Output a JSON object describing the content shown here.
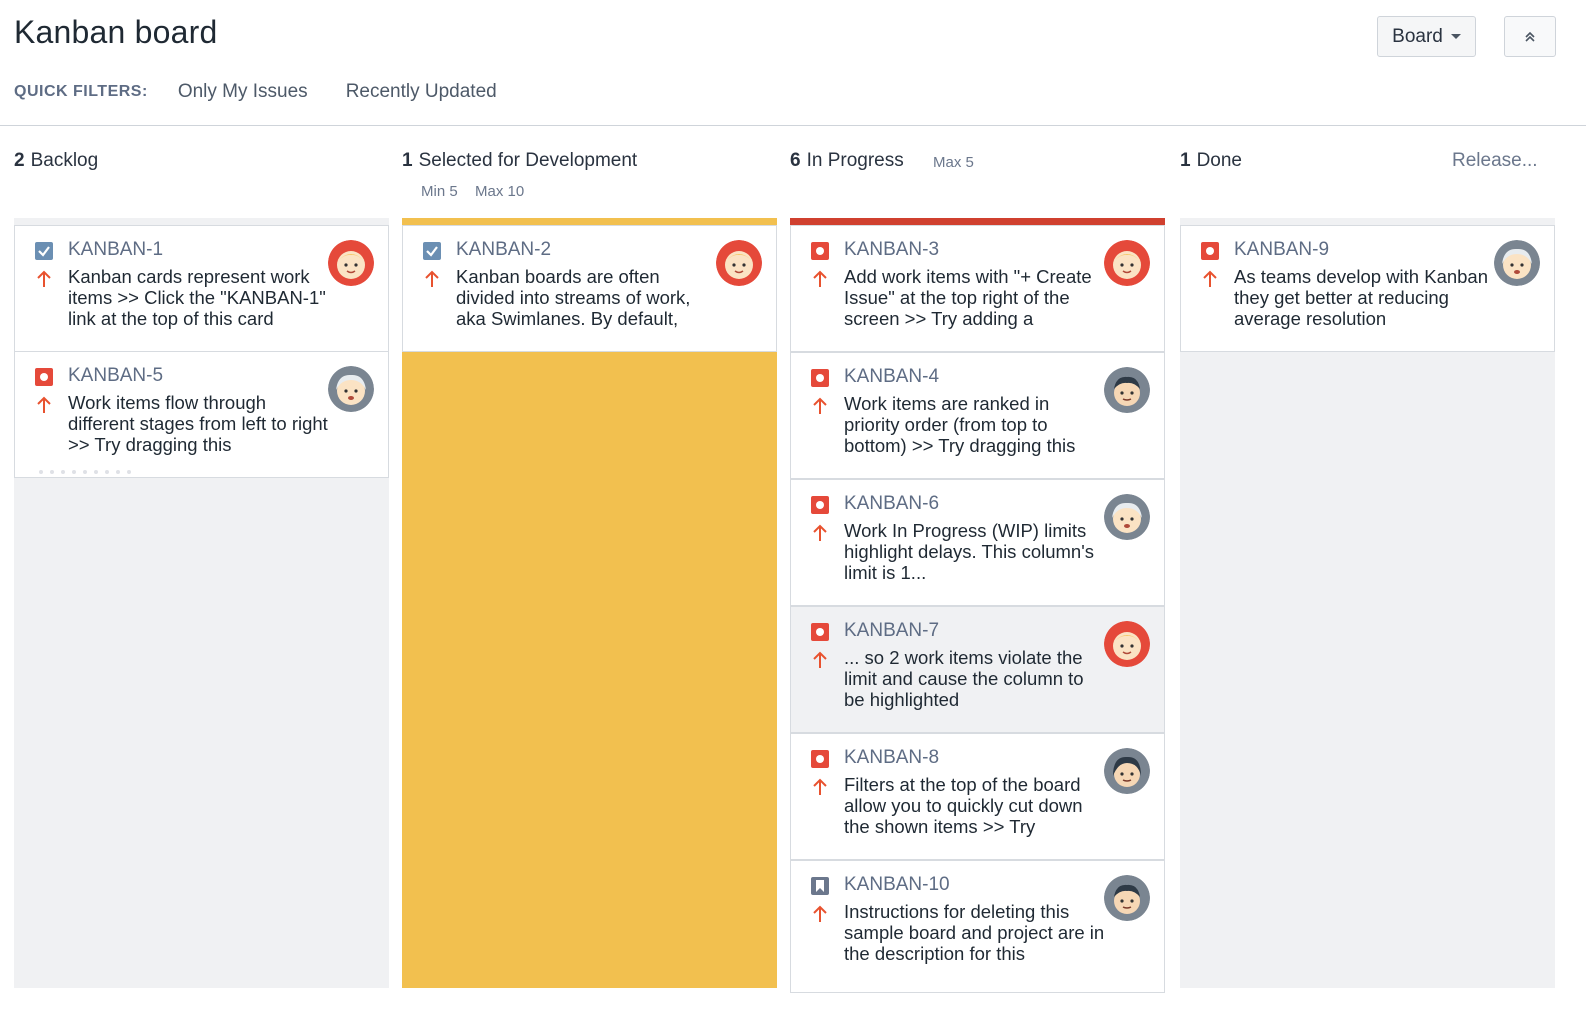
{
  "header": {
    "title": "Kanban board",
    "board_button": "Board"
  },
  "quick_filters": {
    "label": "QUICK FILTERS:",
    "items": [
      "Only My Issues",
      "Recently Updated"
    ]
  },
  "columns": [
    {
      "count": "2",
      "name": "Backlog"
    },
    {
      "count": "1",
      "name": "Selected for Development",
      "min": "Min 5",
      "max": "Max 10"
    },
    {
      "count": "6",
      "name": "In Progress",
      "max": "Max 5"
    },
    {
      "count": "1",
      "name": "Done",
      "release": "Release..."
    }
  ],
  "cards": {
    "backlog": [
      {
        "key": "KANBAN-1",
        "type": "task",
        "summary": "Kanban cards represent work items >> Click the \"KANBAN-1\" link at the top of this card"
      },
      {
        "key": "KANBAN-5",
        "type": "bug",
        "summary": "Work items flow through different stages from left to right >> Try dragging this"
      }
    ],
    "selected": [
      {
        "key": "KANBAN-2",
        "type": "task",
        "summary": "Kanban boards are often divided into streams of work, aka Swimlanes. By default,"
      }
    ],
    "in_progress": [
      {
        "key": "KANBAN-3",
        "type": "bug",
        "summary": "Add work items with \"+ Create Issue\" at the top right of the screen >> Try adding a"
      },
      {
        "key": "KANBAN-4",
        "type": "bug",
        "summary": "Work items are ranked in priority order (from top to bottom) >> Try dragging this"
      },
      {
        "key": "KANBAN-6",
        "type": "bug",
        "summary": "Work In Progress (WIP) limits highlight delays. This column's limit is 1..."
      },
      {
        "key": "KANBAN-7",
        "type": "bug",
        "summary": "... so 2 work items violate the limit and cause the column to be highlighted"
      },
      {
        "key": "KANBAN-8",
        "type": "bug",
        "summary": "Filters at the top of the board allow you to quickly cut down the shown items >> Try"
      },
      {
        "key": "KANBAN-10",
        "type": "story",
        "summary": "Instructions for deleting this sample board and project are in the description for this"
      }
    ],
    "done": [
      {
        "key": "KANBAN-9",
        "type": "bug",
        "summary": "As teams develop with Kanban they get better at reducing average resolution"
      }
    ]
  },
  "colors": {
    "bug": "#e5493a",
    "task": "#6b8fb3",
    "priority": "#e8522f",
    "selected_column": "#f2c04f",
    "wip_exceeded": "#d0402f",
    "column_bg": "#f0f1f3"
  }
}
